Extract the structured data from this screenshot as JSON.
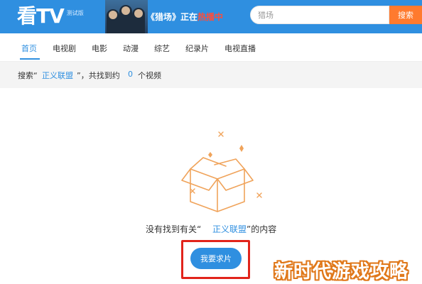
{
  "header": {
    "logo_text": "看TV",
    "logo_badge": "测试版",
    "banner": {
      "pre": "《",
      "show": "猎场",
      "mid": "》正在",
      "status": "热播中"
    },
    "search_value": "猎场",
    "search_button": "搜索"
  },
  "nav": {
    "items": [
      "首页",
      "电视剧",
      "电影",
      "动漫",
      "综艺",
      "纪录片",
      "电视直播"
    ],
    "active_index": 0
  },
  "result": {
    "prefix": "搜索“",
    "keyword": "正义联盟",
    "middle": "”，共找到约",
    "count": "0",
    "suffix": "个视频"
  },
  "empty": {
    "prefix": "没有找到有关“",
    "keyword": "正义联盟",
    "suffix": "”的内容",
    "illustration_icon": "open-box-icon",
    "request_button": "我要求片"
  },
  "watermark": "新时代游戏攻略",
  "colors": {
    "header_bg": "#2f8fe0",
    "accent": "#2f8fe0",
    "search_button": "#ff7a2e",
    "illustration": "#f0a35a",
    "highlight_box": "#e1241b"
  }
}
